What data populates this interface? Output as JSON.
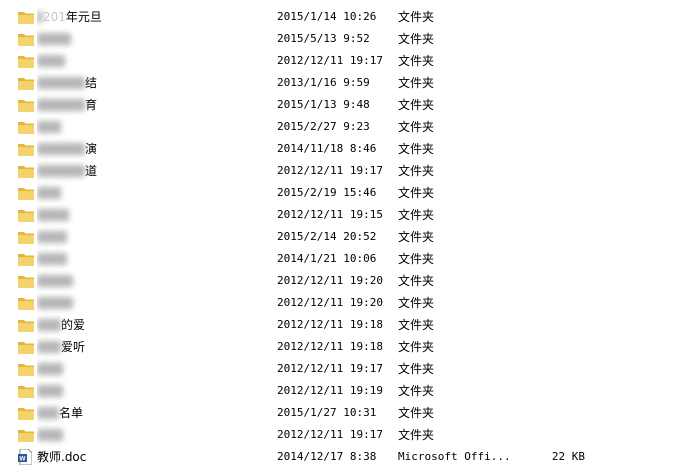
{
  "file_list": {
    "rows": [
      {
        "name_visible": "年元旦",
        "name_prefix": "201",
        "date": "2015/1/14 10:26",
        "type": "文件夹",
        "size": "",
        "icon": "folder-icon"
      },
      {
        "name_visible": "",
        "name_prefix": "",
        "date": "2015/5/13 9:52",
        "type": "文件夹",
        "size": "",
        "icon": "folder-icon"
      },
      {
        "name_visible": "",
        "name_prefix": "",
        "date": "2012/12/11 19:17",
        "type": "文件夹",
        "size": "",
        "icon": "folder-icon"
      },
      {
        "name_visible": "结",
        "name_prefix": "",
        "date": "2013/1/16 9:59",
        "type": "文件夹",
        "size": "",
        "icon": "folder-icon"
      },
      {
        "name_visible": "育",
        "name_prefix": "",
        "date": "2015/1/13 9:48",
        "type": "文件夹",
        "size": "",
        "icon": "folder-icon"
      },
      {
        "name_visible": "",
        "name_prefix": "",
        "date": "2015/2/27 9:23",
        "type": "文件夹",
        "size": "",
        "icon": "folder-icon"
      },
      {
        "name_visible": "演",
        "name_prefix": "",
        "date": "2014/11/18 8:46",
        "type": "文件夹",
        "size": "",
        "icon": "folder-icon"
      },
      {
        "name_visible": "道",
        "name_prefix": "",
        "date": "2012/12/11 19:17",
        "type": "文件夹",
        "size": "",
        "icon": "folder-icon"
      },
      {
        "name_visible": "",
        "name_prefix": "",
        "date": "2015/2/19 15:46",
        "type": "文件夹",
        "size": "",
        "icon": "folder-icon"
      },
      {
        "name_visible": "",
        "name_prefix": "",
        "date": "2012/12/11 19:15",
        "type": "文件夹",
        "size": "",
        "icon": "folder-icon"
      },
      {
        "name_visible": "",
        "name_prefix": "",
        "date": "2015/2/14 20:52",
        "type": "文件夹",
        "size": "",
        "icon": "folder-icon"
      },
      {
        "name_visible": "",
        "name_prefix": "",
        "date": "2014/1/21 10:06",
        "type": "文件夹",
        "size": "",
        "icon": "folder-icon"
      },
      {
        "name_visible": "",
        "name_prefix": "",
        "date": "2012/12/11 19:20",
        "type": "文件夹",
        "size": "",
        "icon": "folder-icon"
      },
      {
        "name_visible": "",
        "name_prefix": "",
        "date": "2012/12/11 19:20",
        "type": "文件夹",
        "size": "",
        "icon": "folder-icon"
      },
      {
        "name_visible": "的爱",
        "name_prefix": "",
        "date": "2012/12/11 19:18",
        "type": "文件夹",
        "size": "",
        "icon": "folder-icon"
      },
      {
        "name_visible": "爱听",
        "name_prefix": "",
        "date": "2012/12/11 19:18",
        "type": "文件夹",
        "size": "",
        "icon": "folder-icon"
      },
      {
        "name_visible": "",
        "name_prefix": "",
        "date": "2012/12/11 19:17",
        "type": "文件夹",
        "size": "",
        "icon": "folder-icon"
      },
      {
        "name_visible": "",
        "name_prefix": "",
        "date": "2012/12/11 19:19",
        "type": "文件夹",
        "size": "",
        "icon": "folder-icon"
      },
      {
        "name_visible": "名单",
        "name_prefix": "",
        "date": "2015/1/27 10:31",
        "type": "文件夹",
        "size": "",
        "icon": "folder-icon"
      },
      {
        "name_visible": "",
        "name_prefix": "",
        "date": "2012/12/11 19:17",
        "type": "文件夹",
        "size": "",
        "icon": "folder-icon"
      },
      {
        "name_visible": "教师.doc",
        "name_prefix": "",
        "date": "2014/12/17 8:38",
        "type": "Microsoft Offi...",
        "size": "22 KB",
        "icon": "word-doc-icon"
      }
    ]
  },
  "colors": {
    "folder_front": "#f5d36a",
    "folder_back": "#e2b53e",
    "word_blue": "#2b5797"
  }
}
